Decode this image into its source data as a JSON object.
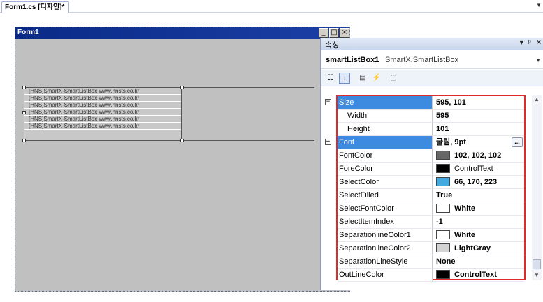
{
  "tab": {
    "title": "Form1.cs [디자인]*"
  },
  "form": {
    "title": "Form1",
    "minimize_glyph": "_",
    "maximize_glyph": "□",
    "close_glyph": "×",
    "list_items": [
      "[HNS]SmartX-SmartListBox www.hnsts.co.kr",
      "[HNS]SmartX-SmartListBox www.hnsts.co.kr",
      "[HNS]SmartX-SmartListBox www.hnsts.co.kr",
      "[HNS]SmartX-SmartListBox www.hnsts.co.kr",
      "[HNS]SmartX-SmartListBox www.hnsts.co.kr",
      "[HNS]SmartX-SmartListBox www.hnsts.co.kr"
    ]
  },
  "properties_panel": {
    "title": "속성",
    "header_icons": {
      "dropdown": "▾",
      "pin": "ᵖ",
      "close": "✕"
    },
    "object_name": "smartListBox1",
    "object_type": "SmartX.SmartListBox",
    "toolbar_icons": [
      "categorized-icon",
      "alphabetical-icon",
      "properties-icon",
      "events-icon",
      "property-pages-icon"
    ],
    "rows": [
      {
        "name": "Size",
        "value": "595, 101",
        "selected": true,
        "expander": "⊟"
      },
      {
        "name": "Width",
        "value": "595",
        "sub": true
      },
      {
        "name": "Height",
        "value": "101",
        "sub": true
      },
      {
        "name": "Font",
        "value": "굴림, 9pt",
        "selected": true,
        "expander": "⊞",
        "button": "..."
      },
      {
        "name": "FontColor",
        "value": "102, 102, 102",
        "swatch": "#666666"
      },
      {
        "name": "ForeColor",
        "value": "ControlText",
        "swatch": "#000000",
        "normal": true
      },
      {
        "name": "SelectColor",
        "value": "66, 170, 223",
        "swatch": "#42aadf"
      },
      {
        "name": "SelectFilled",
        "value": "True"
      },
      {
        "name": "SelectFontColor",
        "value": "White",
        "swatch": "#ffffff"
      },
      {
        "name": "SelectItemIndex",
        "value": "-1"
      },
      {
        "name": "SeparationlineColor1",
        "value": "White",
        "swatch": "#ffffff"
      },
      {
        "name": "SeparationlineColor2",
        "value": "LightGray",
        "swatch": "#d3d3d3"
      },
      {
        "name": "SeparationLineStyle",
        "value": "None"
      },
      {
        "name": "OutLineColor",
        "value": "ControlText",
        "swatch": "#000000"
      }
    ]
  },
  "colors": {
    "highlight": "#3d8be0",
    "grid_border": "#dd2a2a",
    "form_title": "#0a2a86"
  }
}
